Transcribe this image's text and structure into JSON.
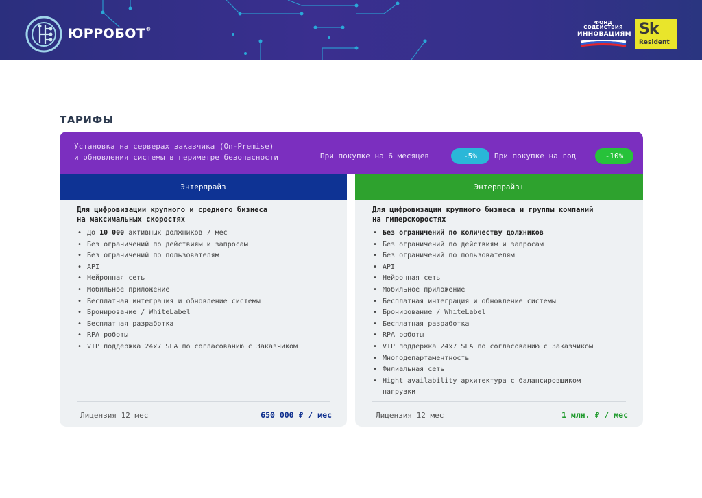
{
  "header": {
    "brand": "ЮРРОБОТ",
    "brand_mark": "®",
    "fund_line1": "ФОНД СОДЕЙСТВИЯ",
    "fund_line2": "ИННОВАЦИЯМ",
    "sk_mark": "Sk",
    "sk_resident": "Resident",
    "colors": {
      "banner": "#35308a",
      "circuit": "#2aa8d8",
      "sk": "#e9e52b"
    }
  },
  "page_title": "ТАРИФЫ",
  "strip": {
    "line1": "Установка на серверах заказчика (On-Premise)",
    "line2": "и обновления системы в периметре безопасности",
    "offer_6m": "При покупке на 6 месяцев",
    "discount_6m": "-5%",
    "offer_year": "При покупке на год",
    "discount_year": "-10%",
    "colors": {
      "strip": "#7b2fbf",
      "pill_6m": "#2ab7d8",
      "pill_year": "#27c23a"
    }
  },
  "plans": [
    {
      "name": "Энтерпрайз",
      "subtitle_line1": "Для цифровизации крупного и среднего бизнеса",
      "subtitle_line2": "на максимальных скоростях",
      "features": [
        {
          "pre": "До ",
          "bold": "10 000",
          "post": " активных должников / мес"
        },
        "Без ограничений по действиям и запросам",
        "Без ограничений по пользователям",
        "API",
        "Нейронная сеть",
        "Мобильное приложение",
        "Бесплатная интеграция и обновление системы",
        "Бронирование / WhiteLabel",
        "Бесплатная разработка",
        "RPA роботы",
        "VIP поддержка 24x7 SLA по согласованию с Заказчиком"
      ],
      "license": "Лицензия 12 мес",
      "price": "650 000 ₽ / мес",
      "color": "#0e3394"
    },
    {
      "name": "Энтерпрайз+",
      "subtitle_line1": "Для цифровизации крупного бизнеса и группы компаний",
      "subtitle_line2": "на гиперскоростях",
      "features": [
        "Без ограничений по количеству должников",
        "Без ограничений по действиям и запросам",
        "Без ограничений по пользователям",
        "API",
        "Нейронная сеть",
        "Мобильное приложение",
        "Бесплатная интеграция и обновление системы",
        "Бронирование / WhiteLabel",
        "Бесплатная разработка",
        "RPA роботы",
        "VIP поддержка 24x7 SLA по согласованию с Заказчиком",
        "Многодепартаментность",
        "Филиальная сеть",
        "Hight availability архитектура с балансировщиком",
        "нагрузки"
      ],
      "license": "Лицензия 12 мес",
      "price": "1 млн. ₽ / мес",
      "color": "#2ea22e"
    }
  ]
}
